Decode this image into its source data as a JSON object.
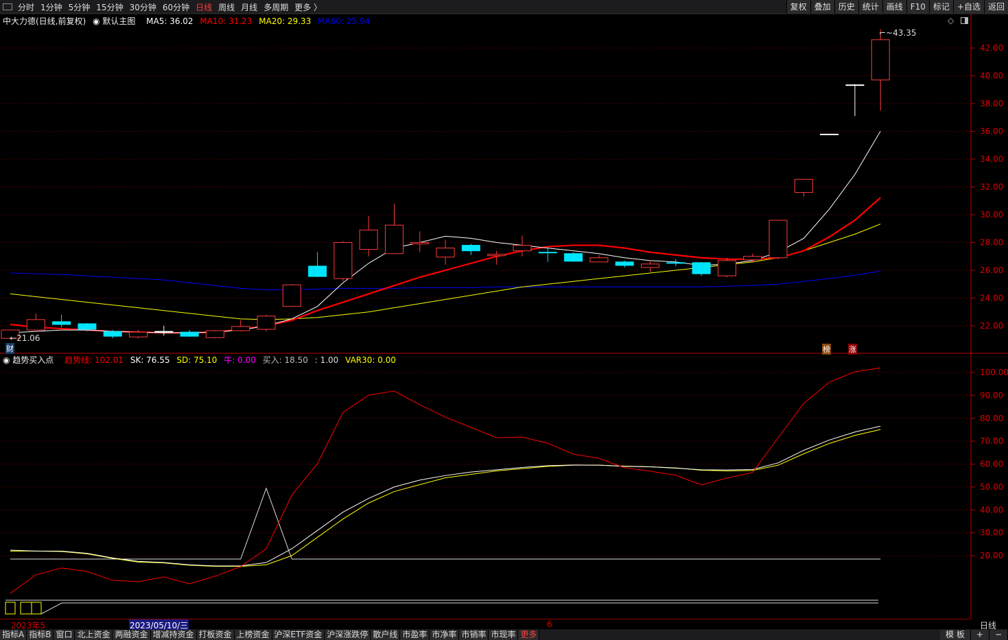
{
  "topbar": {
    "periods": [
      "分时",
      "1分钟",
      "5分钟",
      "15分钟",
      "30分钟",
      "60分钟",
      "日线",
      "周线",
      "月线",
      "多周期",
      "更多 〉"
    ],
    "active": "日线",
    "actions": [
      "复权",
      "叠加",
      "历史",
      "统计",
      "画线",
      "F10",
      "标记",
      "+自选",
      "返回"
    ]
  },
  "legend": {
    "title": "中大力德(日线,前复权)",
    "main": "默认主图",
    "ma5": "MA5: 36.02",
    "ma10": "MA10: 31.23",
    "ma20": "MA20: 29.33",
    "ma60": "MA60: 25.94"
  },
  "indicator_legend": {
    "name": "趋势买入点",
    "trend": "趋势线: 102.01",
    "sk": "SK: 76.55",
    "sd": "SD: 75.10",
    "bull": "牛: 0.00",
    "buy": "买入: 18.50",
    "blank": ": 1.00",
    "var30": "VAR30: 0.00"
  },
  "labels": {
    "low": "21.06",
    "high": "43.35",
    "cai": "财",
    "bang": "榜",
    "zhang": "涨"
  },
  "datebar": {
    "start": "2023年5",
    "cursor_date": "2023/05/10/三",
    "mark": "6",
    "period": "日线"
  },
  "tabs": [
    "指标A",
    "指标B",
    "窗口",
    "北上资金",
    "两融资金",
    "增减持资金",
    "打板资金",
    "上榜资金",
    "沪深ETF资金",
    "沪深涨跌停",
    "散户线",
    "市盈率",
    "市净率",
    "市销率",
    "市现率",
    "更多"
  ],
  "bottom_right": [
    "模 板",
    "+",
    "−"
  ],
  "colors": {
    "up": "#ff3b3b",
    "down": "#00e5ff",
    "ma5": "#ffffff",
    "ma10": "#ff0000",
    "ma20": "#ffff00",
    "ma60": "#0000ff",
    "axis": "#c00000"
  },
  "chart_data": {
    "type": "candlestick",
    "price_axis": {
      "ticks": [
        "42.00",
        "40.00",
        "38.00",
        "36.00",
        "34.00",
        "32.00",
        "30.00",
        "28.00",
        "26.00",
        "24.00",
        "22.00"
      ],
      "range": [
        22,
        42
      ]
    },
    "candles": [
      [
        21.1,
        21.7,
        21.7,
        21.06
      ],
      [
        21.7,
        22.45,
        22.9,
        21.7
      ],
      [
        22.3,
        22.1,
        22.8,
        21.9
      ],
      [
        22.15,
        21.75,
        22.2,
        21.6
      ],
      [
        21.6,
        21.25,
        21.7,
        21.1
      ],
      [
        21.2,
        21.55,
        21.7,
        21.1
      ],
      [
        21.6,
        21.6,
        22.0,
        21.3
      ],
      [
        21.55,
        21.25,
        21.7,
        21.2
      ],
      [
        21.15,
        21.65,
        21.7,
        21.1
      ],
      [
        21.65,
        21.95,
        22.4,
        21.6
      ],
      [
        21.75,
        22.7,
        22.8,
        21.6
      ],
      [
        23.4,
        24.95,
        25.0,
        23.4
      ],
      [
        26.3,
        25.55,
        27.3,
        25.5
      ],
      [
        25.4,
        28.0,
        28.1,
        25.2
      ],
      [
        27.5,
        28.9,
        29.9,
        27.0
      ],
      [
        27.2,
        29.25,
        30.8,
        27.2
      ],
      [
        27.9,
        28.0,
        28.8,
        27.3
      ],
      [
        26.95,
        27.6,
        28.2,
        26.4
      ],
      [
        27.8,
        27.4,
        27.9,
        27.1
      ],
      [
        27.05,
        27.15,
        27.4,
        26.4
      ],
      [
        27.4,
        27.8,
        28.5,
        27.0
      ],
      [
        27.3,
        27.25,
        27.6,
        26.6
      ],
      [
        27.2,
        26.65,
        27.3,
        26.6
      ],
      [
        26.6,
        26.9,
        27.1,
        26.6
      ],
      [
        26.6,
        26.35,
        26.7,
        26.2
      ],
      [
        26.2,
        26.45,
        26.7,
        25.9
      ],
      [
        26.55,
        26.5,
        26.8,
        26.3
      ],
      [
        26.55,
        25.75,
        26.6,
        25.6
      ],
      [
        25.6,
        26.7,
        26.9,
        25.5
      ],
      [
        26.75,
        27.0,
        27.2,
        26.6
      ],
      [
        26.9,
        29.6,
        29.6,
        26.8
      ],
      [
        31.6,
        32.55,
        32.55,
        31.3
      ],
      [
        35.8,
        35.8,
        35.8,
        35.8
      ],
      [
        39.35,
        39.35,
        39.4,
        37.1
      ],
      [
        39.7,
        42.6,
        43.35,
        37.5
      ]
    ],
    "ma5": [
      21.5,
      21.6,
      21.7,
      21.7,
      21.6,
      21.55,
      21.5,
      21.5,
      21.55,
      21.7,
      22.0,
      22.5,
      23.4,
      25.1,
      26.5,
      27.6,
      28.0,
      28.45,
      28.3,
      28.0,
      27.8,
      27.6,
      27.4,
      27.2,
      26.9,
      26.7,
      26.6,
      26.35,
      26.45,
      26.7,
      27.3,
      28.3,
      30.4,
      32.9,
      36.02
    ],
    "ma10": [
      22.1,
      21.9,
      21.8,
      21.7,
      21.6,
      21.55,
      21.5,
      21.5,
      21.55,
      21.75,
      22.0,
      22.4,
      23.1,
      23.7,
      24.3,
      24.9,
      25.5,
      26.0,
      26.5,
      27.0,
      27.4,
      27.7,
      27.8,
      27.8,
      27.6,
      27.3,
      27.1,
      26.9,
      26.8,
      26.8,
      26.9,
      27.4,
      28.4,
      29.6,
      31.23
    ],
    "ma20": [
      24.3,
      24.1,
      23.9,
      23.7,
      23.5,
      23.3,
      23.1,
      22.9,
      22.7,
      22.5,
      22.45,
      22.5,
      22.6,
      22.8,
      23.0,
      23.3,
      23.6,
      23.9,
      24.2,
      24.5,
      24.8,
      25.0,
      25.2,
      25.4,
      25.6,
      25.8,
      26.0,
      26.2,
      26.4,
      26.6,
      26.9,
      27.4,
      28.0,
      28.6,
      29.33
    ],
    "ma60": [
      25.8,
      25.75,
      25.7,
      25.6,
      25.5,
      25.4,
      25.3,
      25.1,
      24.9,
      24.7,
      24.6,
      24.6,
      24.65,
      24.7,
      24.7,
      24.7,
      24.75,
      24.75,
      24.75,
      24.8,
      24.8,
      24.8,
      24.8,
      24.8,
      24.8,
      24.8,
      24.8,
      24.8,
      24.85,
      24.9,
      25.0,
      25.2,
      25.4,
      25.65,
      25.94
    ],
    "indicator_axis": {
      "ticks": [
        "100.00",
        "90.00",
        "80.00",
        "70.00",
        "60.00",
        "50.00",
        "40.00",
        "30.00",
        "20.00"
      ],
      "range": [
        20,
        100
      ]
    },
    "trend": [
      3.5,
      11.6,
      14.6,
      13.1,
      9.2,
      8.6,
      10.7,
      7.7,
      11.0,
      15.2,
      23.0,
      46.4,
      60.2,
      82.6,
      90.1,
      91.9,
      85.9,
      80.5,
      76.0,
      71.5,
      71.8,
      69.1,
      64.3,
      62.5,
      58.4,
      56.9,
      55.1,
      50.9,
      53.9,
      56.3,
      71.5,
      86.5,
      95.8,
      100.3,
      102.01
    ],
    "sk": [
      22.4,
      22.0,
      22.0,
      21.0,
      19.0,
      17.5,
      17.0,
      16.0,
      15.5,
      15.5,
      17.0,
      23,
      31,
      39,
      45,
      50,
      53,
      55,
      56.5,
      57.5,
      58.5,
      59.3,
      59.6,
      59.5,
      59.0,
      58.8,
      58.2,
      57.5,
      57.4,
      57.6,
      60.5,
      66,
      70.5,
      74,
      76.55
    ],
    "sd": [
      22.0,
      22.0,
      21.8,
      20.8,
      18.8,
      17.2,
      16.8,
      15.8,
      15.3,
      15.3,
      16.0,
      20,
      28,
      36,
      43,
      48,
      51,
      54,
      55.5,
      57,
      58,
      59,
      59.5,
      59.5,
      59.1,
      58.8,
      58.3,
      57.3,
      57.0,
      57.2,
      59.5,
      64.5,
      69,
      72.5,
      75.1
    ],
    "buy": [
      18.5,
      18.5,
      18.5,
      18.5,
      18.5,
      18.5,
      18.5,
      18.5,
      18.5,
      18.5,
      49.4,
      18.5,
      18.5,
      18.5,
      18.5,
      18.5,
      18.5,
      18.5,
      18.5,
      18.5,
      18.5,
      18.5,
      18.5,
      18.5,
      18.5,
      18.5,
      18.5,
      18.5,
      18.5,
      18.5,
      18.5,
      18.5,
      18.5,
      18.5,
      18.5
    ]
  }
}
